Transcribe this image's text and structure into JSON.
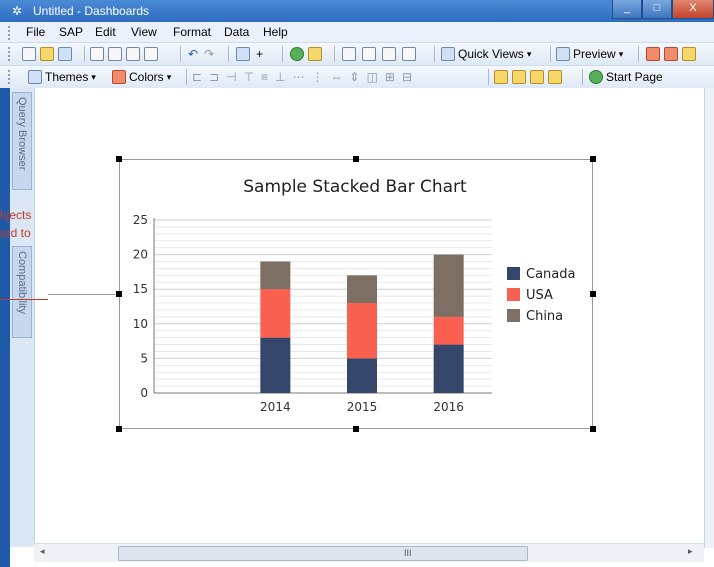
{
  "window": {
    "title": "Untitled - Dashboards"
  },
  "menu": [
    "File",
    "SAP",
    "Edit",
    "View",
    "Format",
    "Data",
    "Help"
  ],
  "toolbar1": {
    "quick_views": "Quick Views",
    "preview": "Preview"
  },
  "toolbar2": {
    "themes": "Themes",
    "colors": "Colors",
    "start_page": "Start Page"
  },
  "side_panel": {
    "query_browser": "Query Browser",
    "compatibility": "Compatibility"
  },
  "annotation": {
    "line1": "bjects",
    "line2": "ard to"
  },
  "scrollbar": {
    "grip": "III"
  },
  "chart_data": {
    "type": "bar",
    "stacked": true,
    "title": "Sample Stacked Bar Chart",
    "categories": [
      "2014",
      "2015",
      "2016"
    ],
    "series": [
      {
        "name": "Canada",
        "values": [
          8,
          5,
          7
        ],
        "color": "#34476b"
      },
      {
        "name": "USA",
        "values": [
          7,
          8,
          4
        ],
        "color": "#f9604f"
      },
      {
        "name": "China",
        "values": [
          4,
          4,
          9
        ],
        "color": "#7d6f63"
      }
    ],
    "ylim": [
      0,
      25
    ],
    "yticks": [
      0,
      5,
      10,
      15,
      20,
      25
    ],
    "grid": true,
    "legend_position": "right"
  }
}
